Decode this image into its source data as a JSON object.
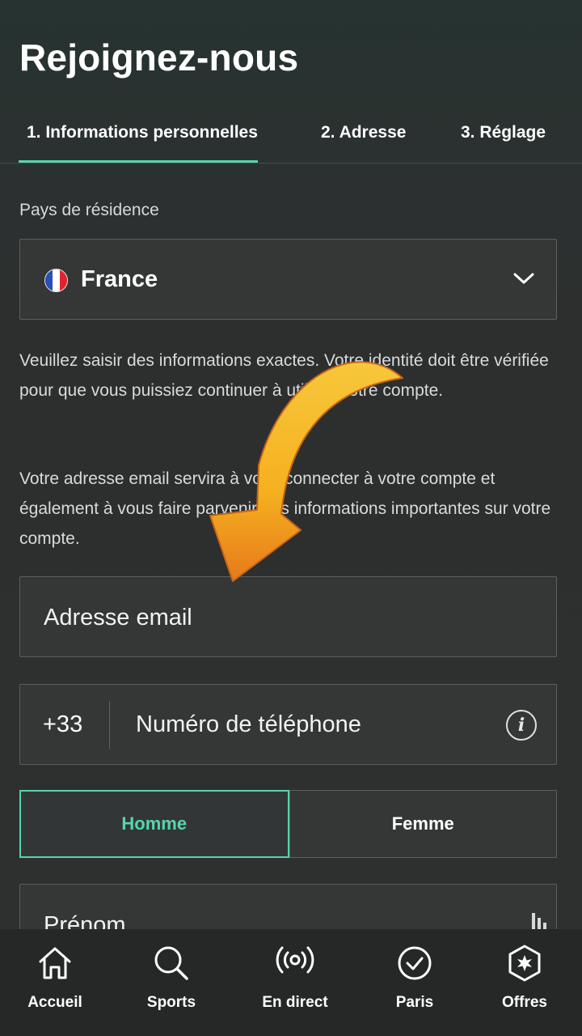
{
  "page": {
    "title": "Rejoignez-nous"
  },
  "steps": [
    {
      "label": "1.  Informations personnelles",
      "active": true
    },
    {
      "label": "2.  Adresse",
      "active": false
    },
    {
      "label": "3.  Réglage",
      "active": false
    }
  ],
  "country": {
    "label": "Pays de résidence",
    "value": "France",
    "flag_icon": "france-flag-icon"
  },
  "info": {
    "paragraph1": "Veuillez saisir des informations exactes. Votre identité doit être vérifiée pour que vous puissiez continuer à utiliser votre compte.",
    "paragraph2": "Votre adresse email servira à vous connecter à votre compte et également à vous faire parvenir des informations importantes sur votre compte."
  },
  "email": {
    "placeholder": "Adresse email"
  },
  "phone": {
    "prefix": "+33",
    "placeholder": "Numéro de téléphone",
    "info_icon": "i"
  },
  "gender": {
    "options": [
      "Homme",
      "Femme"
    ],
    "selected": "Homme"
  },
  "firstname": {
    "placeholder": "Prénom"
  },
  "nav": [
    {
      "label": "Accueil",
      "icon": "home-icon"
    },
    {
      "label": "Sports",
      "icon": "search-icon"
    },
    {
      "label": "En direct",
      "icon": "live-broadcast-icon"
    },
    {
      "label": "Paris",
      "icon": "check-circle-icon"
    },
    {
      "label": "Offres",
      "icon": "offers-badge-icon"
    }
  ],
  "colors": {
    "accent": "#55d6ad",
    "background": "#2e2f2f",
    "nav_background": "#262727",
    "arrow": "#f5b521"
  }
}
